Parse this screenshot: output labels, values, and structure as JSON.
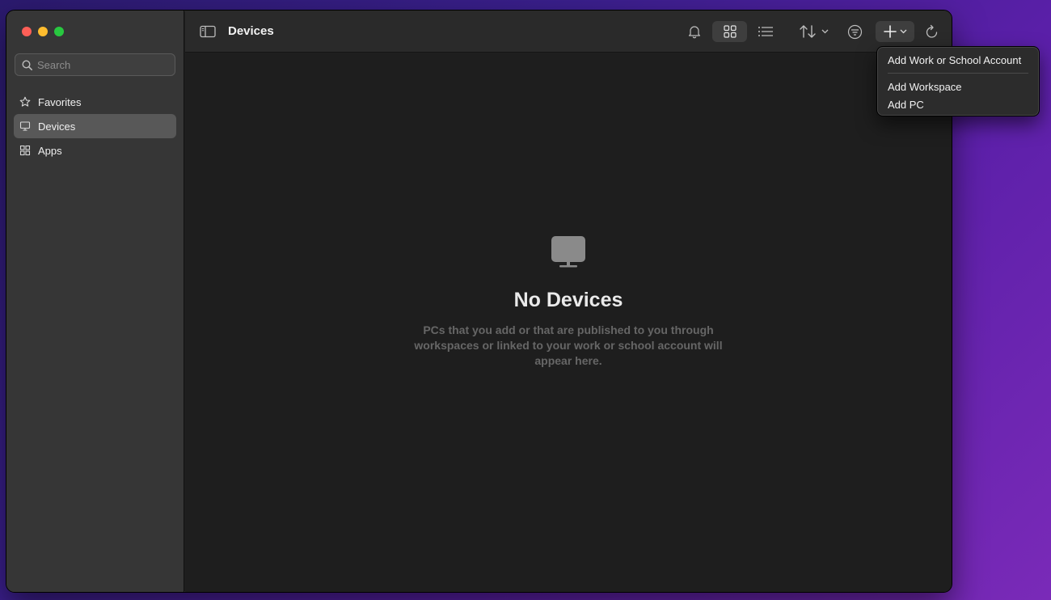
{
  "sidebar": {
    "search_placeholder": "Search",
    "items": [
      {
        "label": "Favorites",
        "icon": "star-icon"
      },
      {
        "label": "Devices",
        "icon": "monitor-icon",
        "active": true
      },
      {
        "label": "Apps",
        "icon": "apps-icon"
      }
    ]
  },
  "toolbar": {
    "title": "Devices",
    "icons": [
      "sidebar-toggle-icon",
      "bell-icon",
      "grid-view-icon",
      "list-view-icon",
      "sort-icon",
      "filter-icon",
      "add-icon",
      "refresh-icon"
    ]
  },
  "empty_state": {
    "icon": "monitor-icon",
    "title": "No Devices",
    "message": "PCs that you add or that are published to you through workspaces or linked to your work or school account will appear here."
  },
  "add_menu": {
    "items": [
      "Add Work or School Account",
      "Add Workspace",
      "Add PC"
    ]
  },
  "colors": {
    "close": "#fe5f57",
    "minimize": "#febc2e",
    "maximize": "#28c840"
  }
}
